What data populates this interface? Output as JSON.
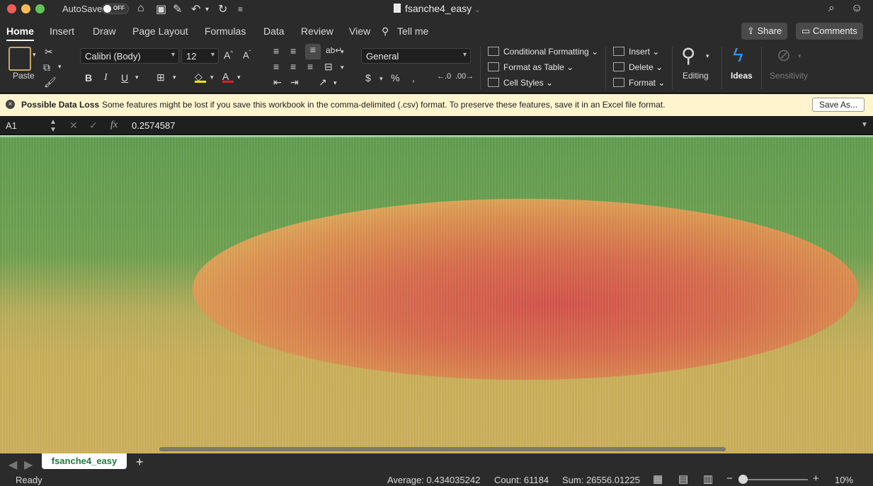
{
  "window": {
    "autosave_label": "AutoSave",
    "autosave_state": "OFF",
    "title": "fsanche4_easy"
  },
  "tabs": [
    "Home",
    "Insert",
    "Draw",
    "Page Layout",
    "Formulas",
    "Data",
    "Review",
    "View"
  ],
  "tell_me": "Tell me",
  "share_label": "Share",
  "comments_label": "Comments",
  "ribbon": {
    "paste_label": "Paste",
    "font_name": "Calibri (Body)",
    "font_size": "12",
    "number_format": "General",
    "conditional_formatting": "Conditional Formatting",
    "format_as_table": "Format as Table",
    "cell_styles": "Cell Styles",
    "insert": "Insert",
    "delete": "Delete",
    "format": "Format",
    "editing": "Editing",
    "ideas": "Ideas",
    "sensitivity": "Sensitivity"
  },
  "warning": {
    "title": "Possible Data Loss",
    "message": "Some features might be lost if you save this workbook in the comma-delimited (.csv) format. To preserve these features, save it in an Excel file format.",
    "button": "Save As..."
  },
  "formula_bar": {
    "cell_ref": "A1",
    "value": "0.2574587"
  },
  "sheet_tab": "fsanche4_easy",
  "status": {
    "ready": "Ready",
    "average": "Average: 0.434035242",
    "count": "Count: 61184",
    "sum": "Sum: 26556.01225",
    "zoom": "10%"
  },
  "colors": {
    "green": "#5f9b4e",
    "yellow": "#c7ad59",
    "orange": "#d7914f",
    "red": "#d25a48"
  }
}
